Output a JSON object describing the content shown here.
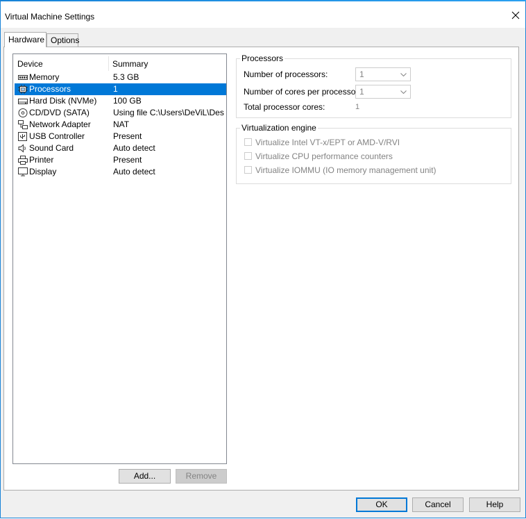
{
  "window": {
    "title": "Virtual Machine Settings"
  },
  "tabs": [
    {
      "label": "Hardware",
      "active": true
    },
    {
      "label": "Options",
      "active": false
    }
  ],
  "device_list": {
    "columns": [
      "Device",
      "Summary"
    ],
    "rows": [
      {
        "icon": "memory-icon",
        "device": "Memory",
        "summary": "5.3 GB",
        "selected": false
      },
      {
        "icon": "processor-icon",
        "device": "Processors",
        "summary": "1",
        "selected": true
      },
      {
        "icon": "hard-disk-icon",
        "device": "Hard Disk (NVMe)",
        "summary": "100 GB",
        "selected": false
      },
      {
        "icon": "cd-dvd-icon",
        "device": "CD/DVD (SATA)",
        "summary": "Using file C:\\Users\\DeViL\\Des...",
        "selected": false
      },
      {
        "icon": "network-adapter-icon",
        "device": "Network Adapter",
        "summary": "NAT",
        "selected": false
      },
      {
        "icon": "usb-icon",
        "device": "USB Controller",
        "summary": "Present",
        "selected": false
      },
      {
        "icon": "speaker-icon",
        "device": "Sound Card",
        "summary": "Auto detect",
        "selected": false
      },
      {
        "icon": "printer-icon",
        "device": "Printer",
        "summary": "Present",
        "selected": false
      },
      {
        "icon": "display-icon",
        "device": "Display",
        "summary": "Auto detect",
        "selected": false
      }
    ]
  },
  "list_buttons": {
    "add": "Add...",
    "remove": "Remove"
  },
  "processors_group": {
    "title": "Processors",
    "num_processors_label": "Number of processors:",
    "num_processors_value": "1",
    "cores_per_processor_label": "Number of cores per processor:",
    "cores_per_processor_value": "1",
    "total_cores_label": "Total processor cores:",
    "total_cores_value": "1"
  },
  "virtualization_group": {
    "title": "Virtualization engine",
    "options": [
      {
        "label": "Virtualize Intel VT-x/EPT or AMD-V/RVI",
        "checked": false
      },
      {
        "label": "Virtualize CPU performance counters",
        "checked": false
      },
      {
        "label": "Virtualize IOMMU (IO memory management unit)",
        "checked": false
      }
    ]
  },
  "footer_buttons": {
    "ok": "OK",
    "cancel": "Cancel",
    "help": "Help"
  },
  "colors": {
    "accent": "#0078d7",
    "selection": "#0078d7",
    "disabled_text": "#838383"
  }
}
